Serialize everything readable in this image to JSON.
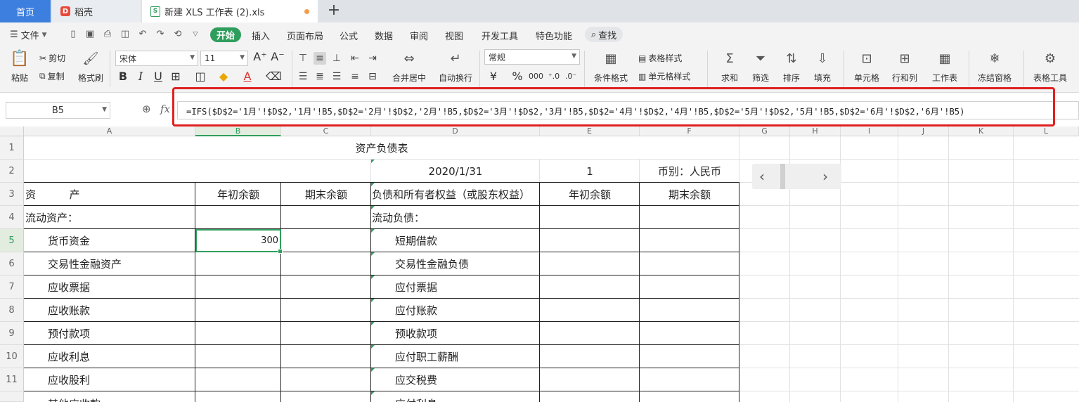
{
  "tabs": {
    "home": "首页",
    "daoke": "稻壳",
    "file": "新建 XLS 工作表 (2).xls",
    "add": "+"
  },
  "menu": {
    "file": "文件",
    "start": "开始",
    "items": [
      "插入",
      "页面布局",
      "公式",
      "数据",
      "审阅",
      "视图",
      "开发工具",
      "特色功能"
    ],
    "search": "查找"
  },
  "toolbar": {
    "paste": "粘贴",
    "cut": "剪切",
    "copy": "复制",
    "format_painter": "格式刷",
    "font_name": "宋体",
    "font_size": "11",
    "merge_center": "合并居中",
    "wrap_text": "自动换行",
    "number_format": "常规",
    "conditional_format": "条件格式",
    "table_style": "表格样式",
    "cell_style": "单元格样式",
    "sum": "求和",
    "filter": "筛选",
    "sort": "排序",
    "fill": "填充",
    "cell": "单元格",
    "row_col": "行和列",
    "worksheet": "工作表",
    "freeze": "冻结窗格",
    "table_tools": "表格工具"
  },
  "formula_bar": {
    "name_box": "B5",
    "fx": "fx",
    "formula": "=IFS($D$2='1月'!$D$2,'1月'!B5,$D$2='2月'!$D$2,'2月'!B5,$D$2='3月'!$D$2,'3月'!B5,$D$2='4月'!$D$2,'4月'!B5,$D$2='5月'!$D$2,'5月'!B5,$D$2='6月'!$D$2,'6月'!B5)"
  },
  "columns": [
    "A",
    "B",
    "C",
    "D",
    "E",
    "F",
    "G",
    "H",
    "I",
    "J",
    "K",
    "L"
  ],
  "rows": [
    "1",
    "2",
    "3",
    "4",
    "5",
    "6",
    "7",
    "8",
    "9",
    "10",
    "11"
  ],
  "sheet": {
    "title": "资产负债表",
    "date": "2020/1/31",
    "e2": "1",
    "currency": "币别：人民币",
    "hdr_asset": "资          产",
    "hdr_begin": "年初余额",
    "hdr_end": "期末余额",
    "hdr_liab": "负债和所有者权益（或股东权益）",
    "hdr_begin2": "年初余额",
    "hdr_end2": "期末余额",
    "assets": [
      "流动资产：",
      "货币资金",
      "交易性金融资产",
      "应收票据",
      "应收账款",
      "预付款项",
      "应收利息",
      "应收股利",
      "其他应收款"
    ],
    "liabilities": [
      "流动负债：",
      "短期借款",
      "交易性金融负债",
      "应付票据",
      "应付账款",
      "预收款项",
      "应付职工薪酬",
      "应交税费",
      "应付利息"
    ],
    "b5": "300"
  },
  "nav": {
    "prev": "‹",
    "next": "›"
  },
  "colors": {
    "accent": "#2f9e5d",
    "home_tab": "#3d7fde",
    "highlight": "#e02020"
  }
}
